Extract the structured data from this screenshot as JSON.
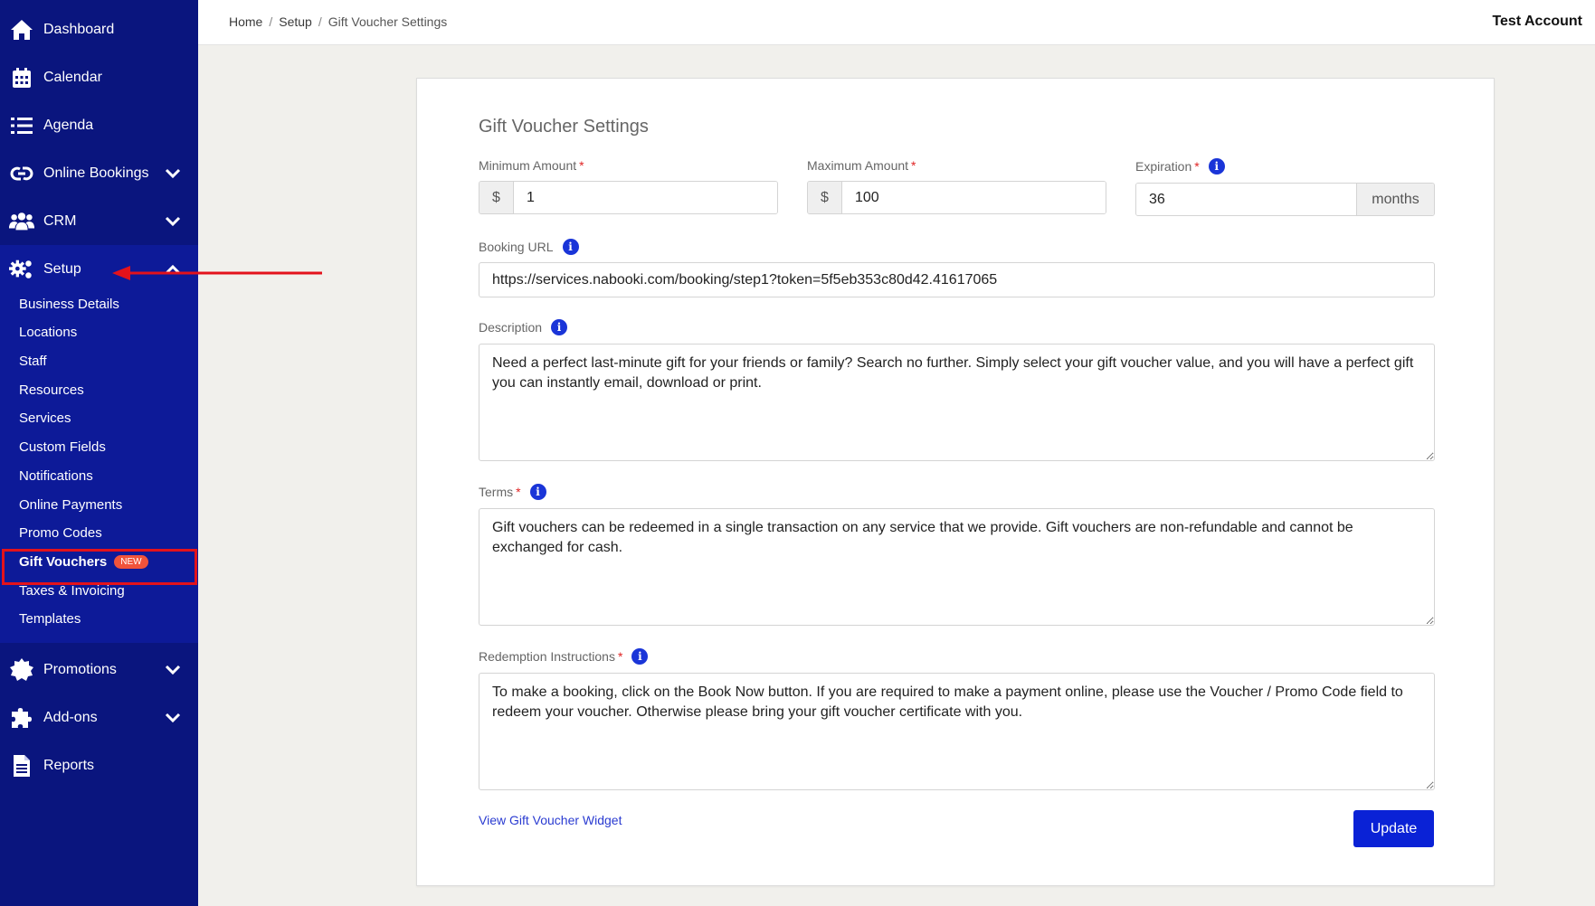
{
  "sidebar": {
    "items": [
      {
        "label": "Dashboard",
        "icon": "home-icon"
      },
      {
        "label": "Calendar",
        "icon": "calendar-icon"
      },
      {
        "label": "Agenda",
        "icon": "list-icon"
      },
      {
        "label": "Online Bookings",
        "icon": "link-icon"
      },
      {
        "label": "CRM",
        "icon": "users-icon"
      },
      {
        "label": "Setup",
        "icon": "gears-icon"
      },
      {
        "label": "Promotions",
        "icon": "badge-icon"
      },
      {
        "label": "Add-ons",
        "icon": "puzzle-icon"
      },
      {
        "label": "Reports",
        "icon": "file-icon"
      }
    ],
    "setup_submenu": [
      "Business Details",
      "Locations",
      "Staff",
      "Resources",
      "Services",
      "Custom Fields",
      "Notifications",
      "Online Payments",
      "Promo Codes",
      "Gift Vouchers",
      "Taxes & Invoicing",
      "Templates"
    ],
    "new_badge": "NEW",
    "active_submenu": "Gift Vouchers"
  },
  "topbar": {
    "breadcrumb": [
      "Home",
      "Setup",
      "Gift Voucher Settings"
    ],
    "account": "Test Account"
  },
  "form": {
    "title": "Gift Voucher Settings",
    "minimum_amount": {
      "label": "Minimum Amount",
      "prefix": "$",
      "value": "1"
    },
    "maximum_amount": {
      "label": "Maximum Amount",
      "prefix": "$",
      "value": "100"
    },
    "expiration": {
      "label": "Expiration",
      "value": "36",
      "suffix": "months"
    },
    "booking_url": {
      "label": "Booking URL",
      "value": "https://services.nabooki.com/booking/step1?token=5f5eb353c80d42.41617065"
    },
    "description": {
      "label": "Description",
      "value": "Need a perfect last-minute gift for your friends or family? Search no further. Simply select your gift voucher value, and you will have a perfect gift you can instantly email, download or print."
    },
    "terms": {
      "label": "Terms",
      "value": "Gift vouchers can be redeemed in a single transaction on any service that we provide. Gift vouchers are non-refundable and cannot be exchanged for cash."
    },
    "redemption": {
      "label": "Redemption Instructions",
      "value": "To make a booking, click on the Book Now button. If you are required to make a payment online, please use the Voucher / Promo Code field to redeem your voucher. Otherwise please bring your gift voucher certificate with you."
    },
    "required_mark": "*",
    "widget_link": "View Gift Voucher Widget",
    "update_button": "Update"
  },
  "colors": {
    "sidebar_bg": "#0a157e",
    "submenu_bg": "#0d1a98",
    "primary": "#0a22d6",
    "badge": "#f0533b",
    "highlight": "#e3121b"
  }
}
